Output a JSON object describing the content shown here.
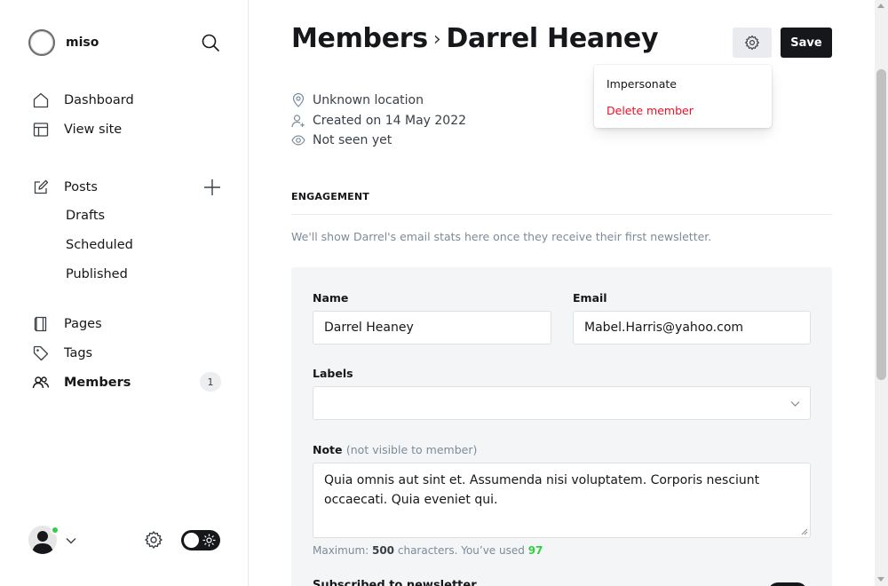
{
  "brand": {
    "name": "miso"
  },
  "sidebar": {
    "items": [
      {
        "label": "Dashboard",
        "icon": "home-icon"
      },
      {
        "label": "View site",
        "icon": "layout-icon"
      },
      {
        "label": "Posts",
        "icon": "edit-icon"
      },
      {
        "label": "Drafts"
      },
      {
        "label": "Scheduled"
      },
      {
        "label": "Published"
      },
      {
        "label": "Pages",
        "icon": "page-icon"
      },
      {
        "label": "Tags",
        "icon": "tag-icon"
      },
      {
        "label": "Members",
        "icon": "members-icon",
        "count": "1"
      }
    ]
  },
  "header": {
    "breadcrumb_parent": "Members",
    "breadcrumb_sep": "›",
    "title": "Darrel Heaney",
    "save_label": "Save"
  },
  "dropdown": {
    "items": [
      {
        "label": "Impersonate"
      },
      {
        "label": "Delete member",
        "color": "#f50b23"
      }
    ]
  },
  "meta": {
    "location": "Unknown location",
    "created": "Created on 14 May 2022",
    "seen": "Not seen yet"
  },
  "engagement": {
    "title": "ENGAGEMENT",
    "note": "We'll show Darrel's email stats here once they receive their first newsletter."
  },
  "form": {
    "name_label": "Name",
    "name_value": "Darrel Heaney",
    "email_label": "Email",
    "email_value": "Mabel.Harris@yahoo.com",
    "labels_label": "Labels",
    "note_label": "Note",
    "note_label_muted": "(not visible to member)",
    "note_value": "Quia omnis aut sint et. Assumenda nisi voluptatem. Corporis nesciunt occaecati. Quia eveniet qui.",
    "hint_prefix": "Maximum: ",
    "hint_max": "500",
    "hint_mid": " characters. You’ve used ",
    "hint_used": "97",
    "subscribed_label": "Subscribed to newsletter"
  },
  "colors": {
    "accent_green": "#30cf43",
    "danger_red": "#f50b23",
    "dark": "#15171a"
  }
}
